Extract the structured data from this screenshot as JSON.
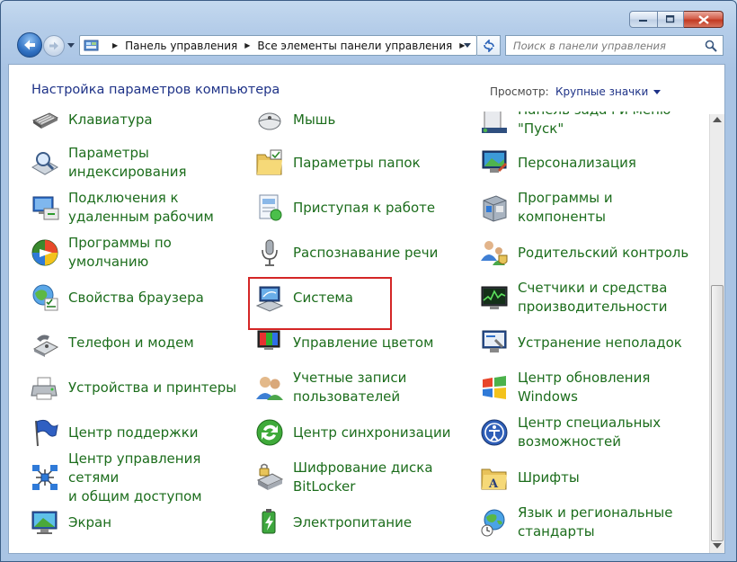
{
  "window": {
    "controls": [
      "minimize",
      "maximize",
      "close"
    ]
  },
  "nav": {
    "address": [
      "Панель управления",
      "Все элементы панели управления"
    ],
    "search_placeholder": "Поиск в панели управления"
  },
  "header": {
    "title": "Настройка параметров компьютера",
    "view_label": "Просмотр:",
    "view_value": "Крупные значки"
  },
  "items": [
    {
      "label": "Клавиатура",
      "icon": "keyboard-icon"
    },
    {
      "label": "Параметры\nиндексирования",
      "icon": "indexing-icon"
    },
    {
      "label": "Подключения к\nудаленным рабочим",
      "icon": "remote-desktop-icon"
    },
    {
      "label": "Программы по\nумолчанию",
      "icon": "default-programs-icon"
    },
    {
      "label": "Свойства браузера",
      "icon": "internet-options-icon"
    },
    {
      "label": "Телефон и модем",
      "icon": "phone-modem-icon"
    },
    {
      "label": "Устройства и принтеры",
      "icon": "printer-icon"
    },
    {
      "label": "Центр поддержки",
      "icon": "action-center-flag-icon"
    },
    {
      "label": "Центр управления сетями\nи общим доступом",
      "icon": "network-icon"
    },
    {
      "label": "Экран",
      "icon": "display-icon"
    },
    {
      "label": "Мышь",
      "icon": "mouse-icon"
    },
    {
      "label": "Параметры папок",
      "icon": "folder-options-icon"
    },
    {
      "label": "Приступая к работе",
      "icon": "getting-started-icon"
    },
    {
      "label": "Распознавание речи",
      "icon": "microphone-icon"
    },
    {
      "label": "Система",
      "icon": "system-icon"
    },
    {
      "label": "Управление цветом",
      "icon": "color-management-icon"
    },
    {
      "label": "Учетные записи\nпользователей",
      "icon": "user-accounts-icon"
    },
    {
      "label": "Центр синхронизации",
      "icon": "sync-center-icon"
    },
    {
      "label": "Шифрование диска\nBitLocker",
      "icon": "bitlocker-icon"
    },
    {
      "label": "Электропитание",
      "icon": "power-options-icon"
    },
    {
      "label": "Панель задач и меню\n\"Пуск\"",
      "icon": "taskbar-icon"
    },
    {
      "label": "Персонализация",
      "icon": "personalization-icon"
    },
    {
      "label": "Программы и\nкомпоненты",
      "icon": "programs-features-icon"
    },
    {
      "label": "Родительский контроль",
      "icon": "parental-controls-icon"
    },
    {
      "label": "Счетчики и средства\nпроизводительности",
      "icon": "performance-icon"
    },
    {
      "label": "Устранение неполадок",
      "icon": "troubleshooting-icon"
    },
    {
      "label": "Центр обновления\nWindows",
      "icon": "windows-update-icon"
    },
    {
      "label": "Центр специальных\nвозможностей",
      "icon": "ease-of-access-icon"
    },
    {
      "label": "Шрифты",
      "icon": "fonts-icon"
    },
    {
      "label": "Язык и региональные\nстандарты",
      "icon": "region-language-icon"
    }
  ],
  "highlighted_item": "Система",
  "colors": {
    "link_green": "#1c6d1c",
    "header_blue": "#1e3287",
    "highlight_red": "#d42626"
  }
}
